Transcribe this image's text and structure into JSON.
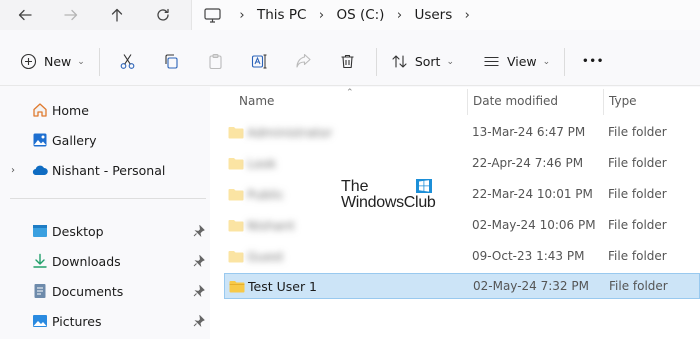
{
  "nav": {
    "breadcrumbs": [
      "This PC",
      "OS (C:)",
      "Users"
    ]
  },
  "toolbar": {
    "new_label": "New",
    "sort_label": "Sort",
    "view_label": "View",
    "more_label": "•••"
  },
  "sidebar": {
    "items": [
      {
        "label": "Home",
        "icon": "home-icon"
      },
      {
        "label": "Gallery",
        "icon": "gallery-icon"
      },
      {
        "label": "Nishant - Personal",
        "icon": "onedrive-cloud-icon"
      },
      {
        "label": "Desktop",
        "icon": "desktop-folder-icon"
      },
      {
        "label": "Downloads",
        "icon": "downloads-icon"
      },
      {
        "label": "Documents",
        "icon": "documents-icon"
      },
      {
        "label": "Pictures",
        "icon": "pictures-icon"
      }
    ]
  },
  "columns": {
    "name": "Name",
    "date": "Date modified",
    "type": "Type"
  },
  "files": [
    {
      "name": "Administrator",
      "date": "13-Mar-24 6:47 PM",
      "type": "File folder"
    },
    {
      "name": "Look",
      "date": "22-Apr-24 7:46 PM",
      "type": "File folder"
    },
    {
      "name": "Public",
      "date": "22-Mar-24 10:01 PM",
      "type": "File folder"
    },
    {
      "name": "Nishant",
      "date": "02-May-24 10:06 PM",
      "type": "File folder"
    },
    {
      "name": "Guest",
      "date": "09-Oct-23 1:43 PM",
      "type": "File folder"
    },
    {
      "name": "Test User 1",
      "date": "02-May-24 7:32 PM",
      "type": "File folder"
    }
  ],
  "watermark": {
    "line1": "The",
    "line2": "WindowsClub"
  },
  "colors": {
    "folder": "#f7c948",
    "selection": "#cce4f7",
    "accent": "#0067c0"
  }
}
